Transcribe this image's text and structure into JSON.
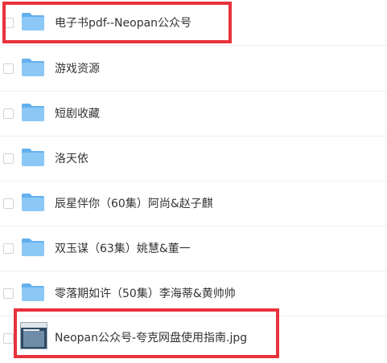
{
  "files": [
    {
      "name": "电子书pdf--Neopan公众号",
      "type": "folder",
      "highlighted": true
    },
    {
      "name": "游戏资源",
      "type": "folder",
      "highlighted": false
    },
    {
      "name": "短剧收藏",
      "type": "folder",
      "highlighted": false
    },
    {
      "name": "洛天依",
      "type": "folder",
      "highlighted": false
    },
    {
      "name": "辰星伴你（60集）阿尚&赵子麒",
      "type": "folder",
      "highlighted": false
    },
    {
      "name": "双玉谋（63集）姚慧&董一",
      "type": "folder",
      "highlighted": false
    },
    {
      "name": "零落期如许（50集）李海蒂&黄帅帅",
      "type": "folder",
      "highlighted": false
    },
    {
      "name": "Neopan公众号-夸克网盘使用指南.jpg",
      "type": "image",
      "highlighted": true
    }
  ],
  "colors": {
    "folder_body": "#8cc8f6",
    "folder_tab": "#63b0ee",
    "highlight": "#e8323c",
    "text": "#333333"
  }
}
